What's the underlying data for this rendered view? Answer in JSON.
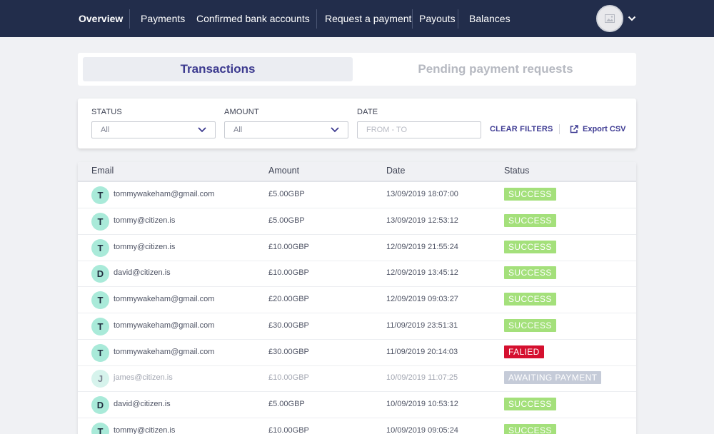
{
  "nav": {
    "items": [
      {
        "label": "Overview",
        "active": true
      },
      {
        "label": "Payments"
      },
      {
        "label": "Confirmed bank accounts"
      },
      {
        "label": "Request a payment"
      },
      {
        "label": "Payouts"
      },
      {
        "label": "Balances"
      }
    ],
    "avatar_icon": "image-placeholder-icon",
    "menu_icon": "chevron-down-icon"
  },
  "tabs": [
    {
      "label": "Transactions",
      "active": true
    },
    {
      "label": "Pending payment requests"
    }
  ],
  "filters": {
    "status": {
      "label": "STATUS",
      "value": "All"
    },
    "amount": {
      "label": "AMOUNT",
      "value": "All"
    },
    "date": {
      "label": "DATE",
      "placeholder": "FROM - TO"
    },
    "clear_label": "CLEAR FILTERS",
    "export_label": "Export CSV"
  },
  "table": {
    "columns": [
      "Email",
      "Amount",
      "Date",
      "Status"
    ],
    "rows": [
      {
        "initial": "T",
        "email": "tommywakeham@gmail.com",
        "amount": "£5.00GBP",
        "date": "13/09/2019 18:07:00",
        "status": "SUCCESS"
      },
      {
        "initial": "T",
        "email": "tommy@citizen.is",
        "amount": "£5.00GBP",
        "date": "13/09/2019 12:53:12",
        "status": "SUCCESS"
      },
      {
        "initial": "T",
        "email": "tommy@citizen.is",
        "amount": "£10.00GBP",
        "date": "12/09/2019 21:55:24",
        "status": "SUCCESS"
      },
      {
        "initial": "D",
        "email": "david@citizen.is",
        "amount": "£10.00GBP",
        "date": "12/09/2019 13:45:12",
        "status": "SUCCESS"
      },
      {
        "initial": "T",
        "email": "tommywakeham@gmail.com",
        "amount": "£20.00GBP",
        "date": "12/09/2019 09:03:27",
        "status": "SUCCESS"
      },
      {
        "initial": "T",
        "email": "tommywakeham@gmail.com",
        "amount": "£30.00GBP",
        "date": "11/09/2019 23:51:31",
        "status": "SUCCESS"
      },
      {
        "initial": "T",
        "email": "tommywakeham@gmail.com",
        "amount": "£30.00GBP",
        "date": "11/09/2019 20:14:03",
        "status": "FALIED"
      },
      {
        "initial": "J",
        "email": "james@citizen.is",
        "amount": "£10.00GBP",
        "date": "10/09/2019 11:07:25",
        "status": "AWAITING PAYMENT"
      },
      {
        "initial": "D",
        "email": "david@citizen.is",
        "amount": "£5.00GBP",
        "date": "10/09/2019 10:53:12",
        "status": "SUCCESS"
      },
      {
        "initial": "T",
        "email": "tommy@citizen.is",
        "amount": "£10.00GBP",
        "date": "10/09/2019 09:05:24",
        "status": "SUCCESS"
      }
    ]
  },
  "colors": {
    "nav_bg": "#222d4b",
    "accent": "#3c3a8f",
    "success": "#a4e07b",
    "failed": "#d5102f",
    "awaiting": "#c5cbd8",
    "avatar": "#a9ead9"
  }
}
